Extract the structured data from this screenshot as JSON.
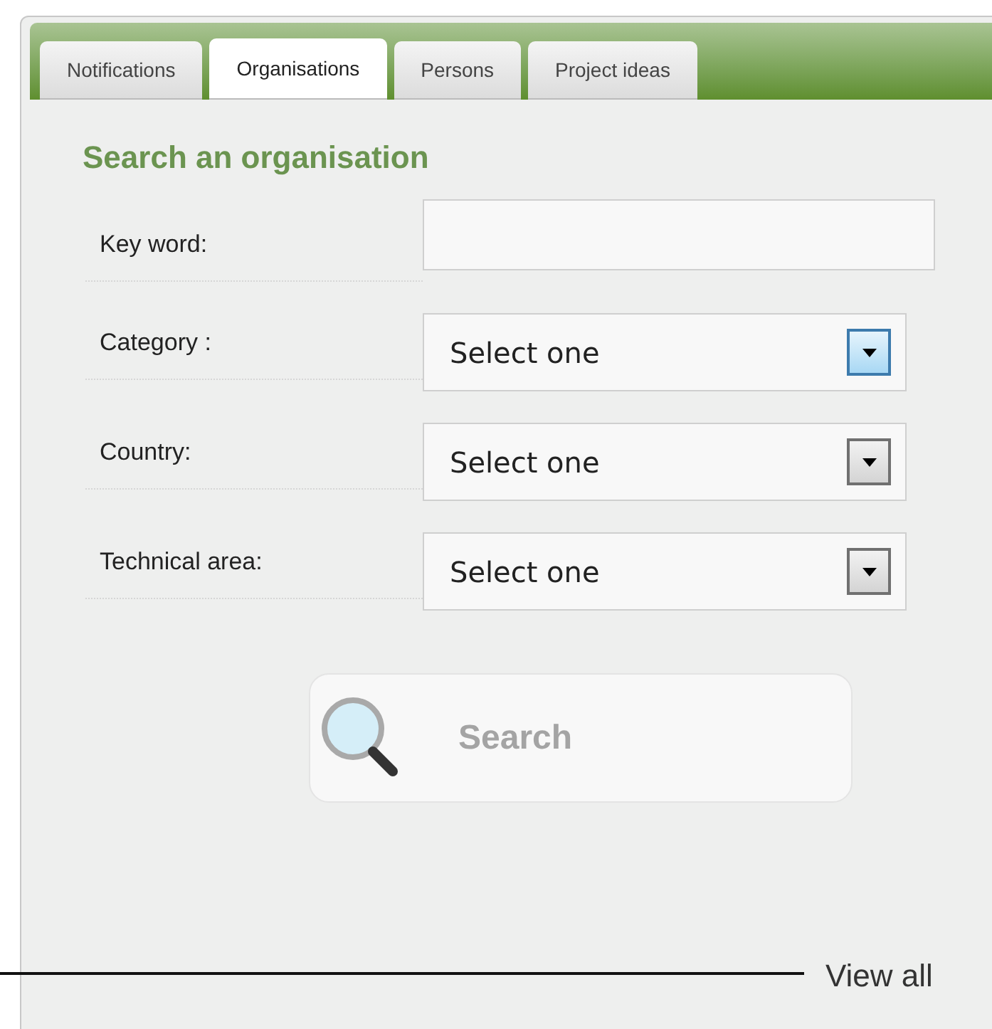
{
  "tabs": [
    {
      "label": "Notifications",
      "selected": false
    },
    {
      "label": "Organisations",
      "selected": true
    },
    {
      "label": "Persons",
      "selected": false
    },
    {
      "label": "Project ideas",
      "selected": false
    }
  ],
  "heading": "Search an organisation",
  "fields": [
    {
      "kind": "text",
      "label": "Key word:"
    },
    {
      "kind": "select",
      "label": "Category :",
      "value": "Select one",
      "focused": true
    },
    {
      "kind": "select",
      "label": "Country:",
      "value": "Select one",
      "focused": false
    },
    {
      "kind": "select",
      "label": "Technical area:",
      "value": "Select one",
      "focused": false
    }
  ],
  "search_button": "Search",
  "view_all": "View all"
}
